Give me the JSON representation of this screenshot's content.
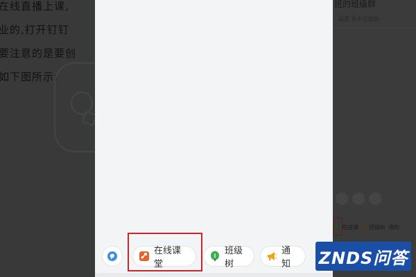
{
  "article": {
    "line1": "在线直播上课,",
    "line2": "业的,打开钉钉",
    "line3": "要注意的是要创",
    "line4": "如下图所示:"
  },
  "toolbar": {
    "avatar_icon": "chat-bubble-icon",
    "classroom": {
      "icon": "classroom-icon",
      "label": "在线课堂",
      "color": "#e8632b"
    },
    "classtree": {
      "icon": "tree-icon",
      "label": "班级树",
      "color": "#3bb04a"
    },
    "notify": {
      "icon": "megaphone-icon",
      "label": "通知",
      "color": "#f2a11c"
    }
  },
  "highlight": {
    "color": "#c8242a"
  },
  "right_pane": {
    "title": "班的班级群",
    "subtitle": "设置 更多班级群",
    "items": [
      "在线课",
      "班级树",
      "通知"
    ]
  },
  "watermark": {
    "text": "ZNDS问答",
    "background": "#1a4fa8"
  }
}
